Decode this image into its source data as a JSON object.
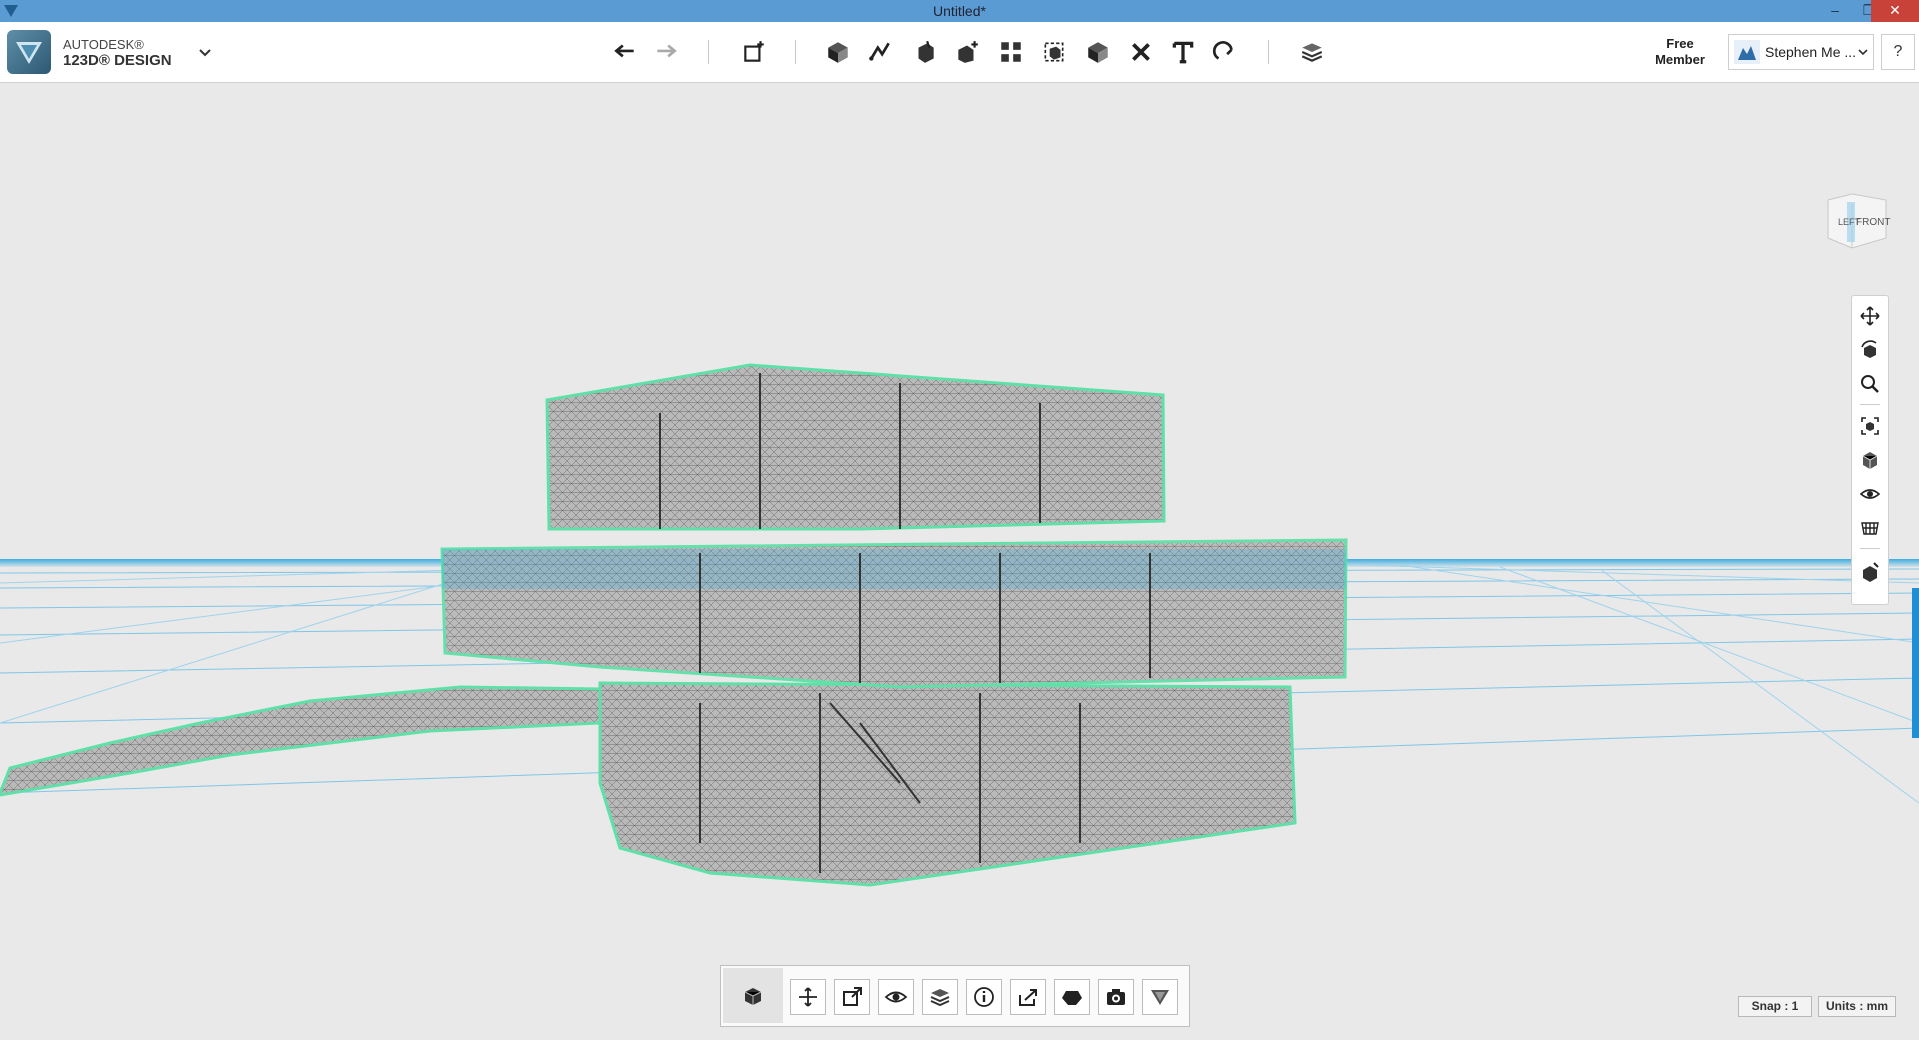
{
  "window": {
    "title": "Untitled*"
  },
  "brand": {
    "line1": "AUTODESK®",
    "line2": "123D® DESIGN"
  },
  "account": {
    "membership_line1": "Free",
    "membership_line2": "Member",
    "user_name": "Stephen Me ...",
    "help_label": "?"
  },
  "viewcube": {
    "left_label": "LEFT",
    "front_label": "FRONT"
  },
  "status": {
    "snap": "Snap : 1",
    "units": "Units : mm"
  },
  "colors": {
    "titlebar": "#5b9bd3",
    "grid": "#2aa6e0",
    "selection": "#5fe0a8",
    "close_button": "#c8423a",
    "accent": "#1e8fd6"
  },
  "toolbar_icons": [
    "undo-icon",
    "redo-icon",
    "primitives-icon",
    "sketch-icon",
    "construct-icon",
    "modify-icon",
    "pattern-icon",
    "grouping-icon",
    "combine-icon",
    "measure-icon",
    "text-icon",
    "snap-icon",
    "material-icon"
  ],
  "nav_icons": [
    "pan-icon",
    "orbit-icon",
    "zoom-icon",
    "fit-icon",
    "views-icon",
    "visibility-icon",
    "grid-icon",
    "material-view-icon"
  ],
  "bottom_icons": [
    "primitive-box-icon",
    "move-icon",
    "scale-icon",
    "visibility-icon",
    "layers-icon",
    "info-icon",
    "export-icon",
    "solid-icon",
    "camera-icon",
    "material-icon"
  ]
}
